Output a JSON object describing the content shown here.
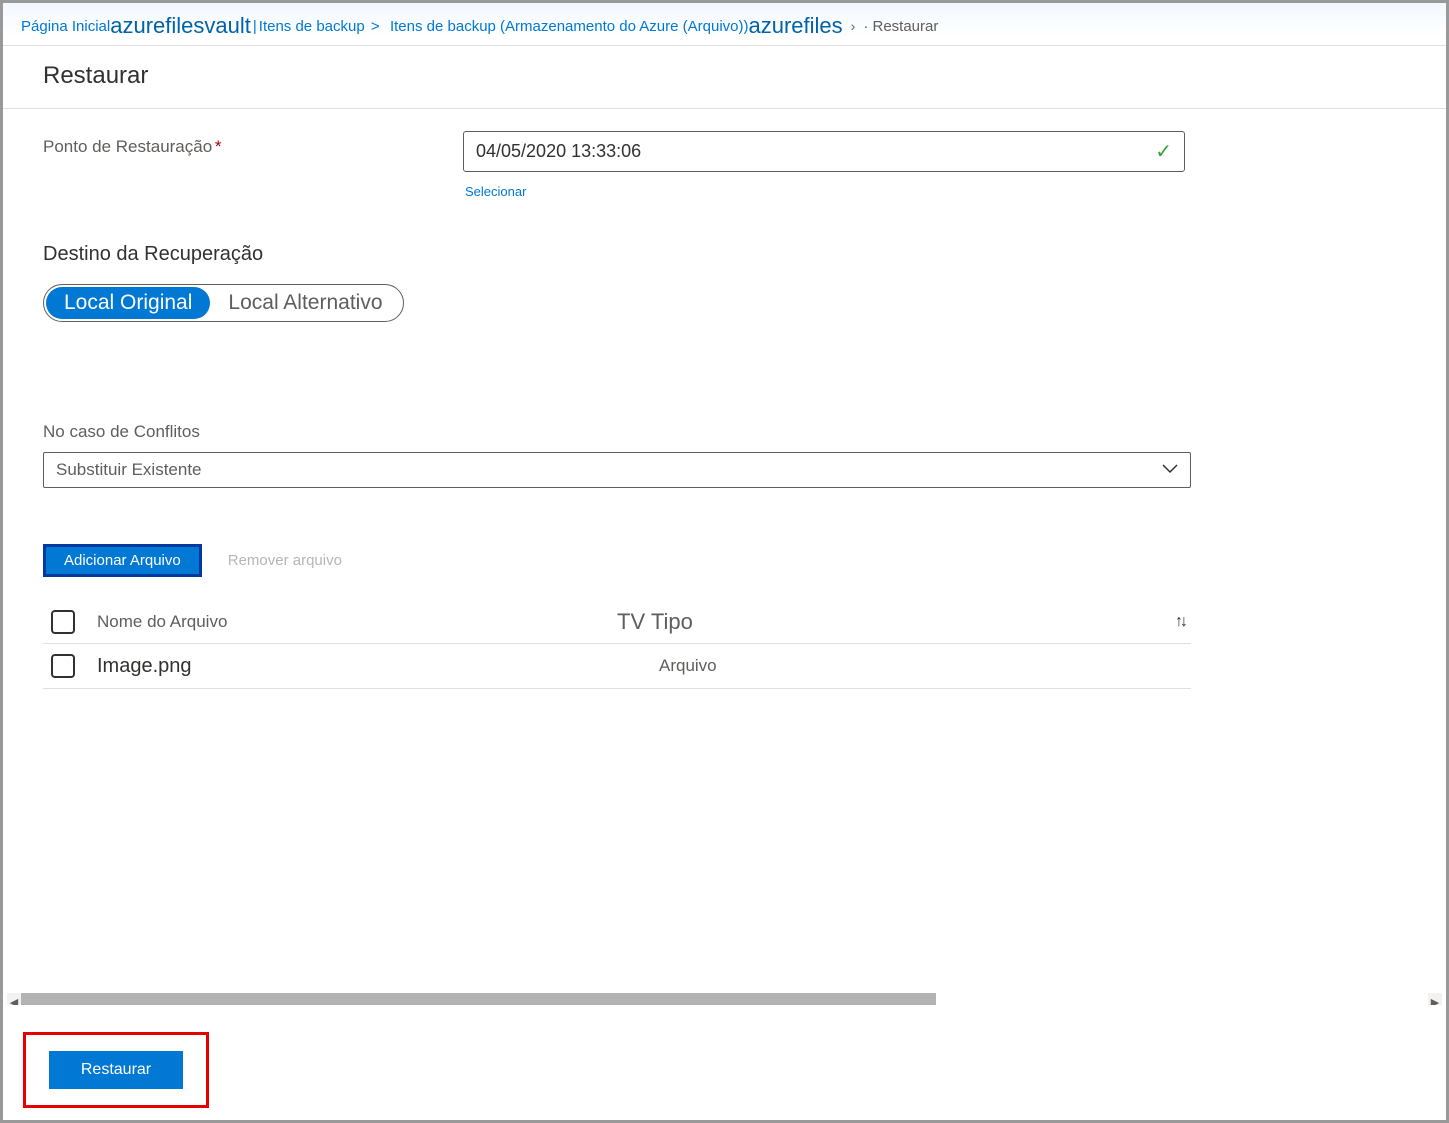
{
  "breadcrumb": {
    "home": "Página Inicial",
    "vault": "azurefilesvault",
    "pipe": " | ",
    "items1": "Itens de backup",
    "items2": "Itens de backup (Armazenamento do Azure (Arquivo))",
    "share": "azurefiles",
    "current": "Restaurar"
  },
  "title": "Restaurar",
  "restorePoint": {
    "label": "Ponto de Restauração",
    "value": "04/05/2020 13:33:06",
    "select": "Selecionar"
  },
  "destination": {
    "heading": "Destino da Recuperação",
    "original": "Local Original",
    "alternate": "Local Alternativo"
  },
  "conflicts": {
    "label": "No caso de Conflitos",
    "value": "Substituir Existente"
  },
  "fileButtons": {
    "add": "Adicionar Arquivo",
    "remove": "Remover arquivo"
  },
  "table": {
    "nameHeader": "Nome do Arquivo",
    "typeHeader": "TV Tipo",
    "rows": [
      {
        "name": "Image.png",
        "type": "Arquivo"
      }
    ]
  },
  "footer": {
    "restore": "Restaurar"
  }
}
